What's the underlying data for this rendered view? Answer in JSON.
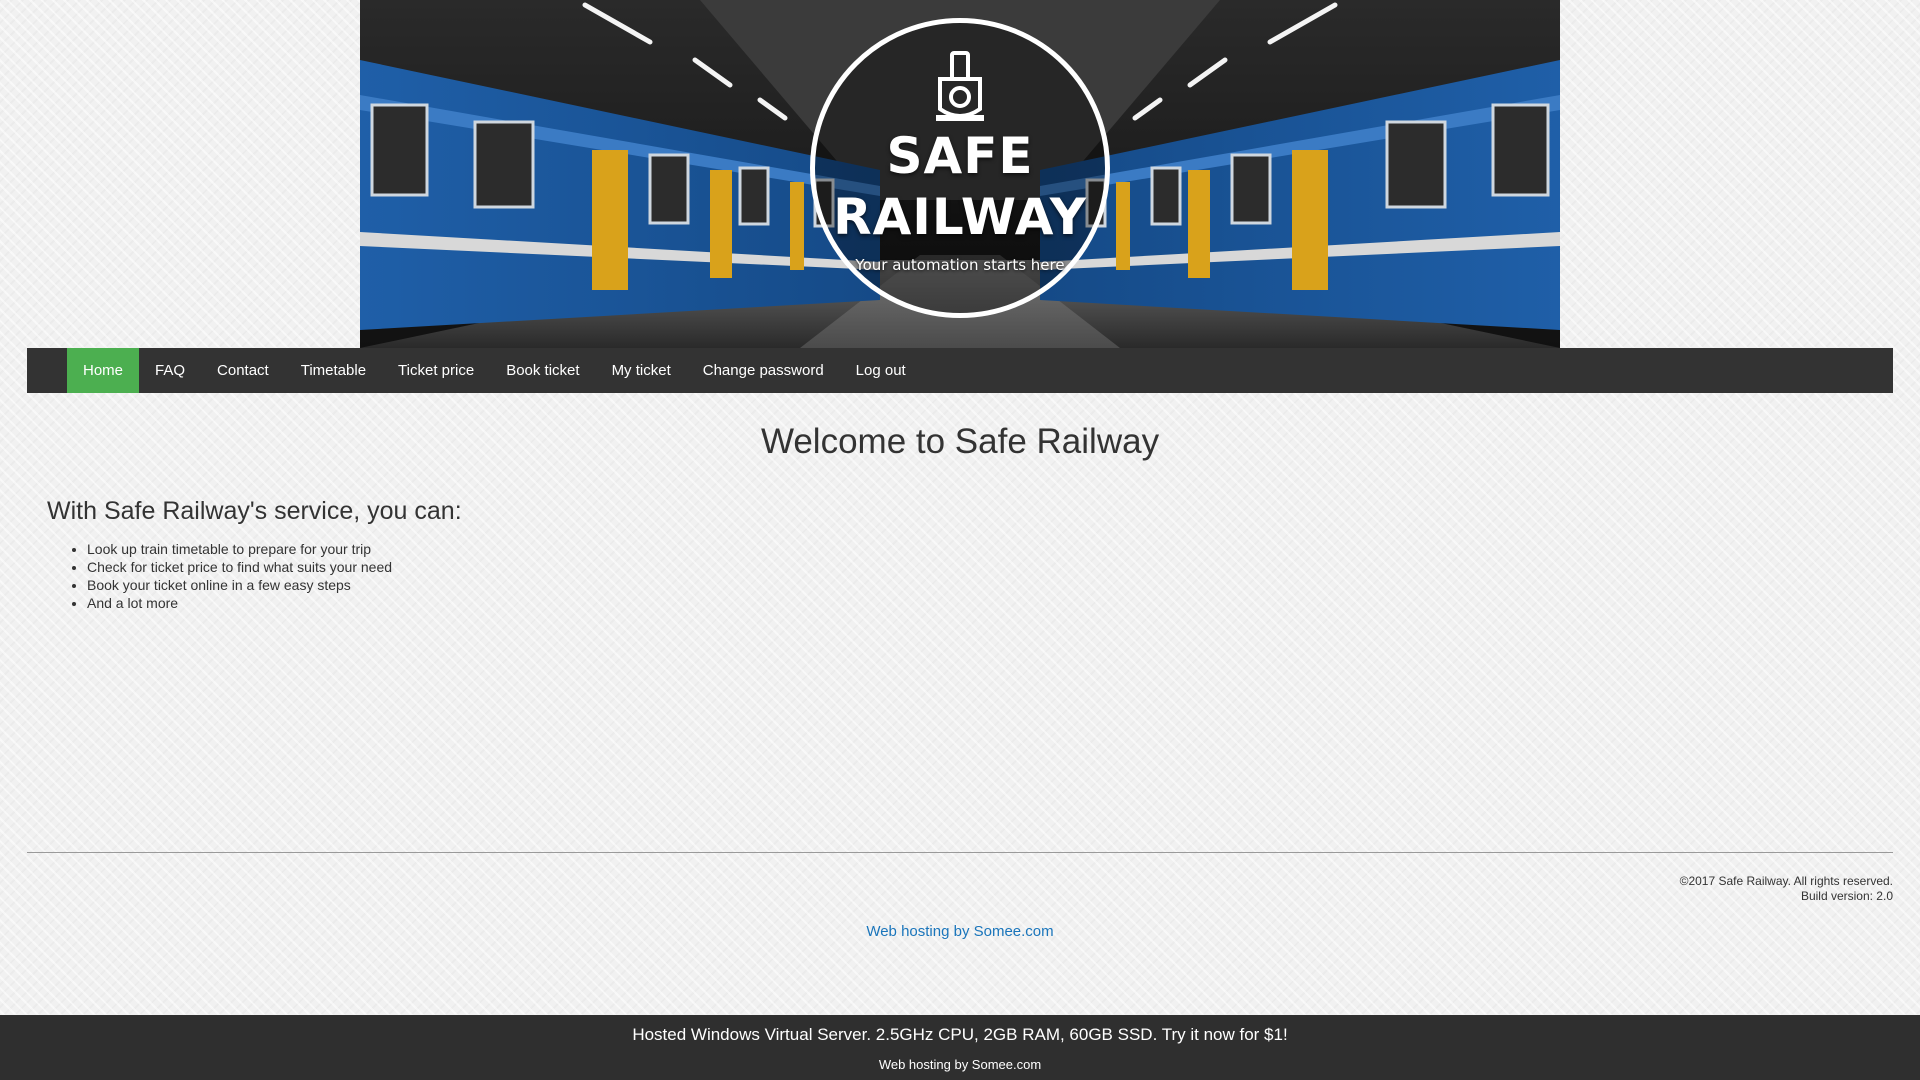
{
  "banner": {
    "brand_line1": "SAFE",
    "brand_line2": "RAILWAY",
    "tagline": "Your automation starts here",
    "logo_icon": "train-icon"
  },
  "nav": {
    "items": [
      {
        "label": "Home",
        "active": true
      },
      {
        "label": "FAQ"
      },
      {
        "label": "Contact"
      },
      {
        "label": "Timetable"
      },
      {
        "label": "Ticket price"
      },
      {
        "label": "Book ticket"
      },
      {
        "label": "My ticket"
      },
      {
        "label": "Change password"
      },
      {
        "label": "Log out"
      }
    ],
    "active_color": "#4caf50",
    "bar_color": "#333333"
  },
  "main": {
    "title": "Welcome to Safe Railway",
    "heading": "With Safe Railway's service, you can:",
    "features": [
      "Look up train timetable to prepare for your trip",
      "Check for ticket price to find what suits your need",
      "Book your ticket online in a few easy steps",
      "And a lot more"
    ]
  },
  "footer": {
    "copyright": "©2017 Safe Railway. All rights reserved.",
    "build": "Build version: 2.0",
    "hosting_link": "Web hosting by Somee.com",
    "link_color": "#1a75bb"
  },
  "ad": {
    "main": "Hosted Windows Virtual Server. 2.5GHz CPU, 2GB RAM, 60GB SSD. Try it now for $1!",
    "sub": "Web hosting by Somee.com"
  }
}
